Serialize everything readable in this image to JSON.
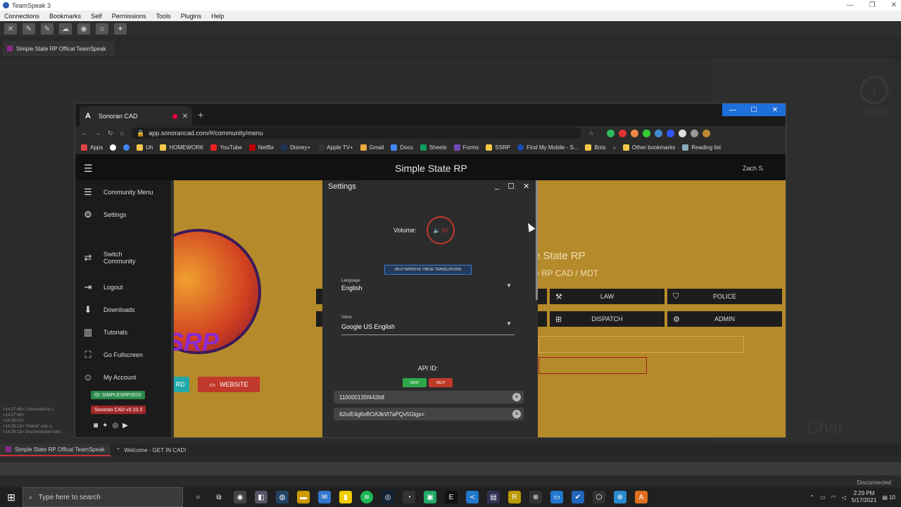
{
  "teamspeak": {
    "title": "TeamSpeak 3",
    "menu": [
      "Connections",
      "Bookmarks",
      "Self",
      "Permissions",
      "Tools",
      "Plugins",
      "Help"
    ],
    "server_tab": "Simple State RP Offical TeamSpeak",
    "info_label": "Info",
    "chat_label": "Chat",
    "log": [
      "<14:27:46> Connected to s",
      "<14:27:46>",
      "<14:28:00>",
      "<14:28:13> \"Name\" was a",
      "<14:28:13> Disconnected from ..."
    ],
    "bottom_tabs": [
      "Simple State RP Offical TeamSpeak",
      "Welcome - GET IN CAD!"
    ],
    "status": "Disconnected"
  },
  "browser": {
    "tab_title": "Sonoran CAD",
    "url": "app.sonorancad.com/#/community/menu",
    "bookmarks": [
      "Apps",
      "Uh",
      "HOMEWORK",
      "YouTube",
      "Netflix",
      "Disney+",
      "Apple TV+",
      "Gmail",
      "Docs",
      "Sheets",
      "Forms",
      "SSRP",
      "Find My Mobile - S...",
      "Bots",
      "Other bookmarks",
      "Reading list"
    ]
  },
  "cad": {
    "title": "Simple State RP",
    "user": "Zach S.",
    "sidebar": [
      {
        "label": "Community Menu",
        "icon": "menu-icon"
      },
      {
        "label": "Settings",
        "icon": "gear-icon"
      },
      {
        "label": "Switch Community",
        "icon": "swap-icon"
      },
      {
        "label": "Logout",
        "icon": "logout-icon"
      },
      {
        "label": "Downloads",
        "icon": "download-icon"
      },
      {
        "label": "Tutorials",
        "icon": "book-icon"
      },
      {
        "label": "Go Fullscreen",
        "icon": "fullscreen-icon"
      },
      {
        "label": "My Account",
        "icon": "user-icon"
      }
    ],
    "id_badge": "ID: SIMPLESRP2020",
    "version_badge": "Sonoran CAD v3.10.3",
    "logo_text": "SSRP",
    "btn_rd": "RD",
    "btn_website": "WEBSITE",
    "right_title1": "e State RP",
    "right_title2": "e RP CAD / MDT",
    "role_buttons": [
      {
        "label": "LAW",
        "icon": "gavel-icon"
      },
      {
        "label": "POLICE",
        "icon": "shield-icon"
      },
      {
        "label": "DISPATCH",
        "icon": "network-icon"
      },
      {
        "label": "ADMIN",
        "icon": "users-gear-icon"
      }
    ]
  },
  "settings": {
    "title": "Settings",
    "volume_label": "Volume:",
    "volume_value": "50",
    "help_translate": "HELP IMPROVE THESE TRANSLATIONS",
    "language_caption": "Language",
    "language_value": "English",
    "voice_caption": "Voice",
    "voice_value": "Google US English",
    "api_label": "API ID:",
    "api_new": "NEW",
    "api_help": "HELP",
    "api_id_1": "110000135f442b8",
    "api_id_2": "62o/E4g6vBOA3kVi7aPQv5Gtgs="
  },
  "taskbar": {
    "search_placeholder": "Type here to search",
    "time": "2:29 PM",
    "date": "5/17/2021",
    "notif": "10"
  }
}
